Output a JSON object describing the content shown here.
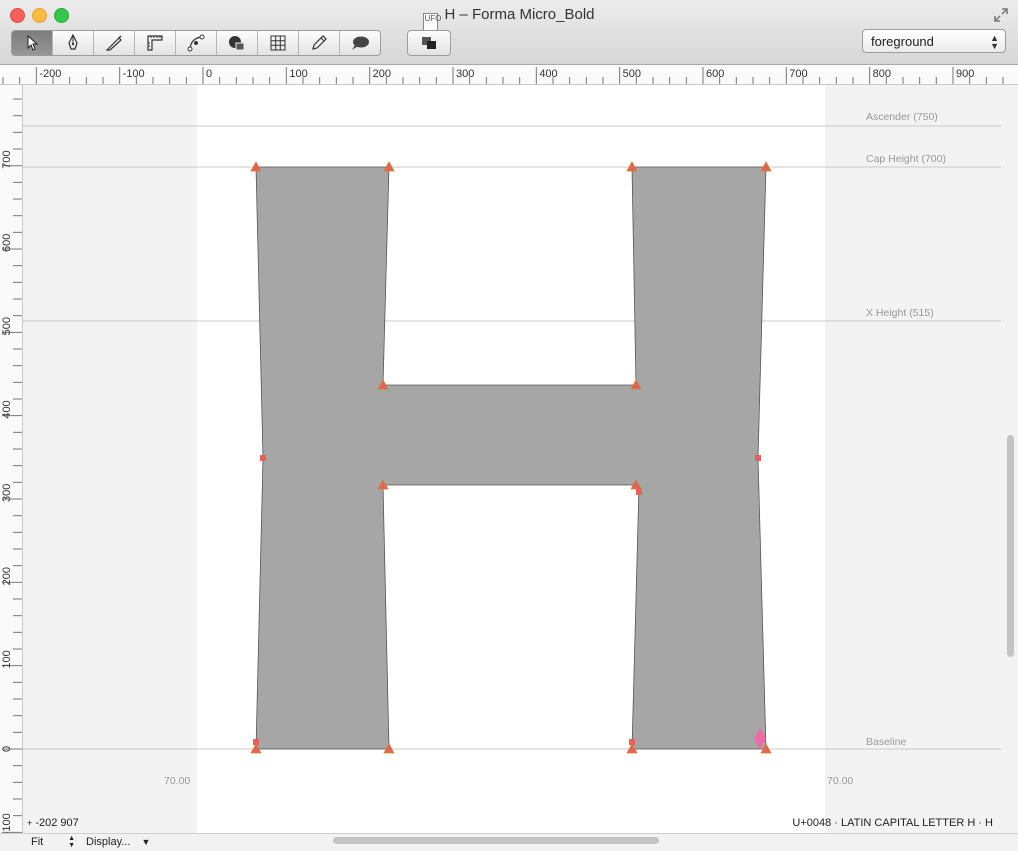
{
  "window": {
    "title": "H – Forma Micro_Bold",
    "doc_icon": "UFO"
  },
  "toolbar": {
    "tools": [
      {
        "name": "pointer-tool",
        "icon": "arrow-pointer-icon",
        "active": true
      },
      {
        "name": "pen-tool",
        "icon": "pen-nib-icon"
      },
      {
        "name": "knife-tool",
        "icon": "knife-icon"
      },
      {
        "name": "ruler-tool",
        "icon": "ruler-icon"
      },
      {
        "name": "shapes-tool",
        "icon": "bezier-node-icon"
      },
      {
        "name": "components-tool",
        "icon": "shapes-icon"
      },
      {
        "name": "grid-tool",
        "icon": "grid-icon"
      },
      {
        "name": "eraser-tool",
        "icon": "pencil-icon"
      },
      {
        "name": "comment-tool",
        "icon": "speech-bubble-icon"
      }
    ],
    "layer_button_icon": "layers-icon",
    "layer_select": {
      "value": "foreground"
    }
  },
  "ruler": {
    "h_labels": [
      "-200",
      "-100",
      "0",
      "100",
      "200",
      "300",
      "400",
      "500",
      "600",
      "700",
      "800",
      "900"
    ],
    "v_labels": [
      "700",
      "600",
      "500",
      "400",
      "300",
      "200",
      "100",
      "0",
      "-100"
    ]
  },
  "metrics": {
    "ascender": "Ascender (750)",
    "cap_height": "Cap Height (700)",
    "x_height": "X Height (515)",
    "baseline": "Baseline"
  },
  "sidebearings": {
    "left": "70.00",
    "right": "70.00"
  },
  "status": {
    "coords": "-202 907",
    "glyph_info": "U+0048 · LATIN CAPITAL LETTER H · H"
  },
  "bottom": {
    "zoom": "Fit",
    "display": "Display..."
  },
  "colors": {
    "glyph_fill": "#a6a6a6",
    "on_curve": "#e8605a",
    "off_curve_marker": "#f06aa8",
    "guide_line": "#c8c8c8"
  }
}
